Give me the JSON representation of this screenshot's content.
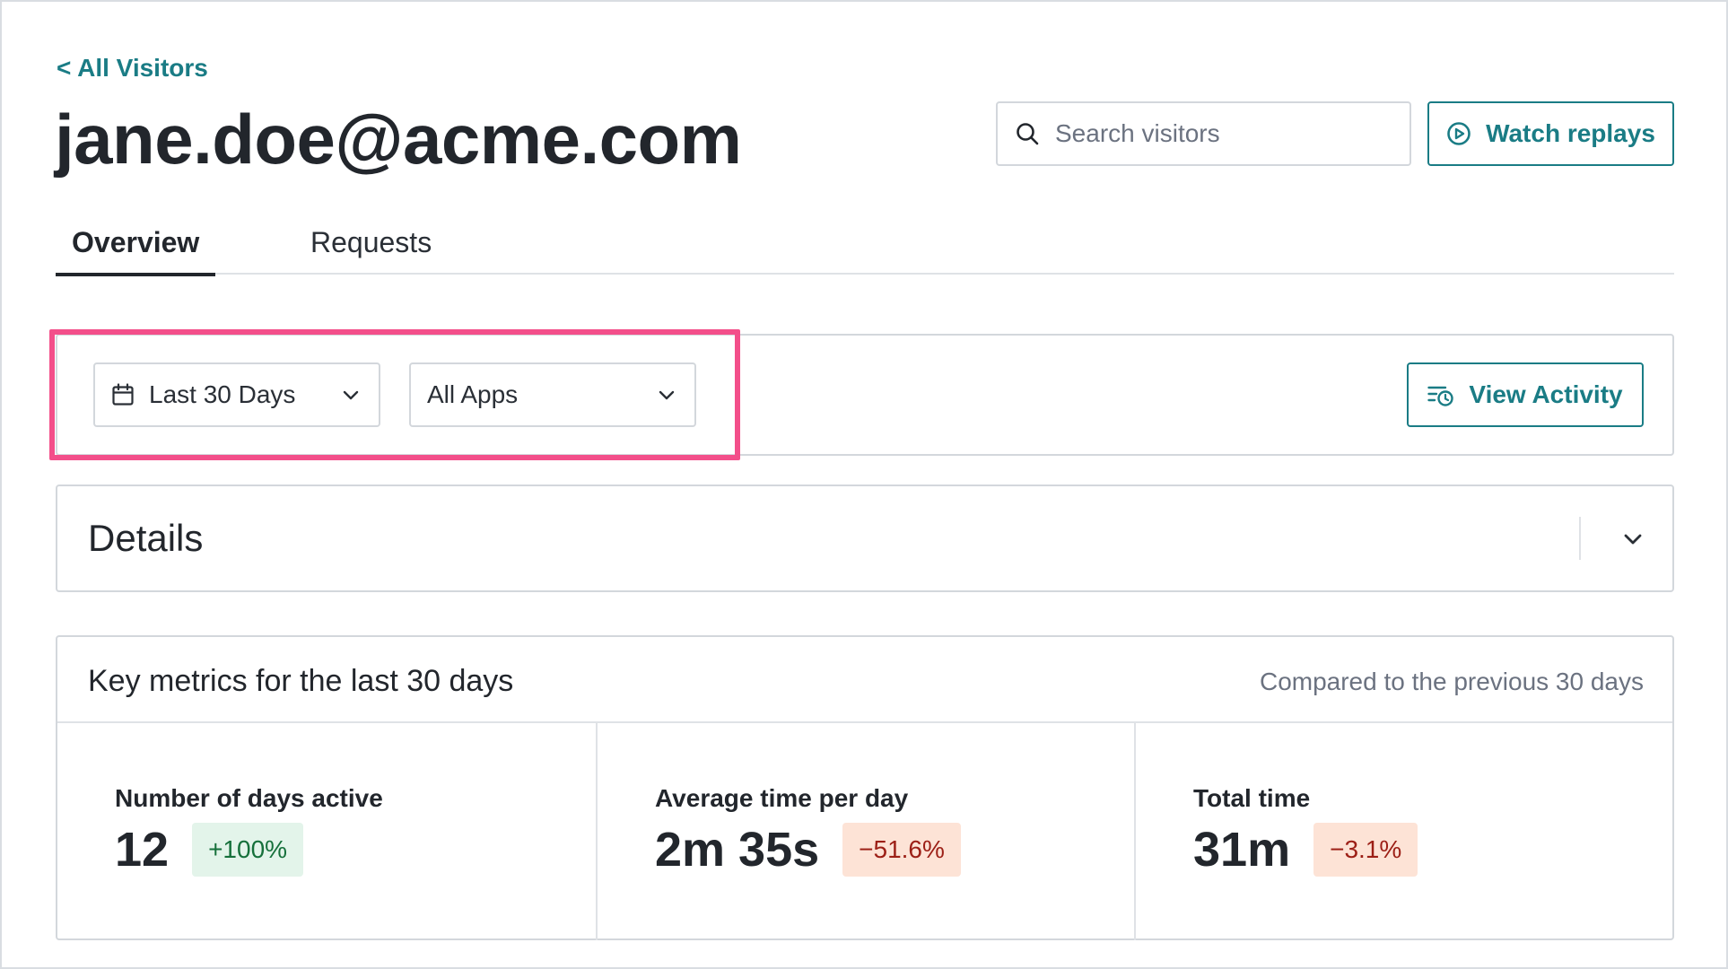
{
  "header": {
    "back_link": "< All Visitors",
    "title": "jane.doe@acme.com",
    "search_placeholder": "Search visitors",
    "watch_replays_label": "Watch replays"
  },
  "tabs": [
    {
      "label": "Overview",
      "active": true
    },
    {
      "label": "Requests",
      "active": false
    }
  ],
  "filters": {
    "date_range": "Last 30 Days",
    "app": "All Apps",
    "view_activity_label": "View Activity",
    "highlight_color": "#f34f8a"
  },
  "details": {
    "title": "Details"
  },
  "metrics": {
    "title": "Key metrics for the last 30 days",
    "compare_note": "Compared to the previous 30 days",
    "items": [
      {
        "label": "Number of days active",
        "value": "12",
        "change": "+100%",
        "trend": "up"
      },
      {
        "label": "Average time per day",
        "value": "2m 35s",
        "change": "−51.6%",
        "trend": "down"
      },
      {
        "label": "Total time",
        "value": "31m",
        "change": "−3.1%",
        "trend": "down"
      }
    ]
  },
  "colors": {
    "accent": "#1a7c85",
    "positive_bg": "#e3f4ea",
    "positive_text": "#16703b",
    "negative_bg": "#fde3d6",
    "negative_text": "#9c1f16"
  },
  "icons": {
    "search": "search-icon",
    "watch": "play-circle-icon",
    "calendar": "calendar-icon",
    "dropdown": "chevron-down-icon",
    "activity": "activity-list-clock-icon"
  }
}
